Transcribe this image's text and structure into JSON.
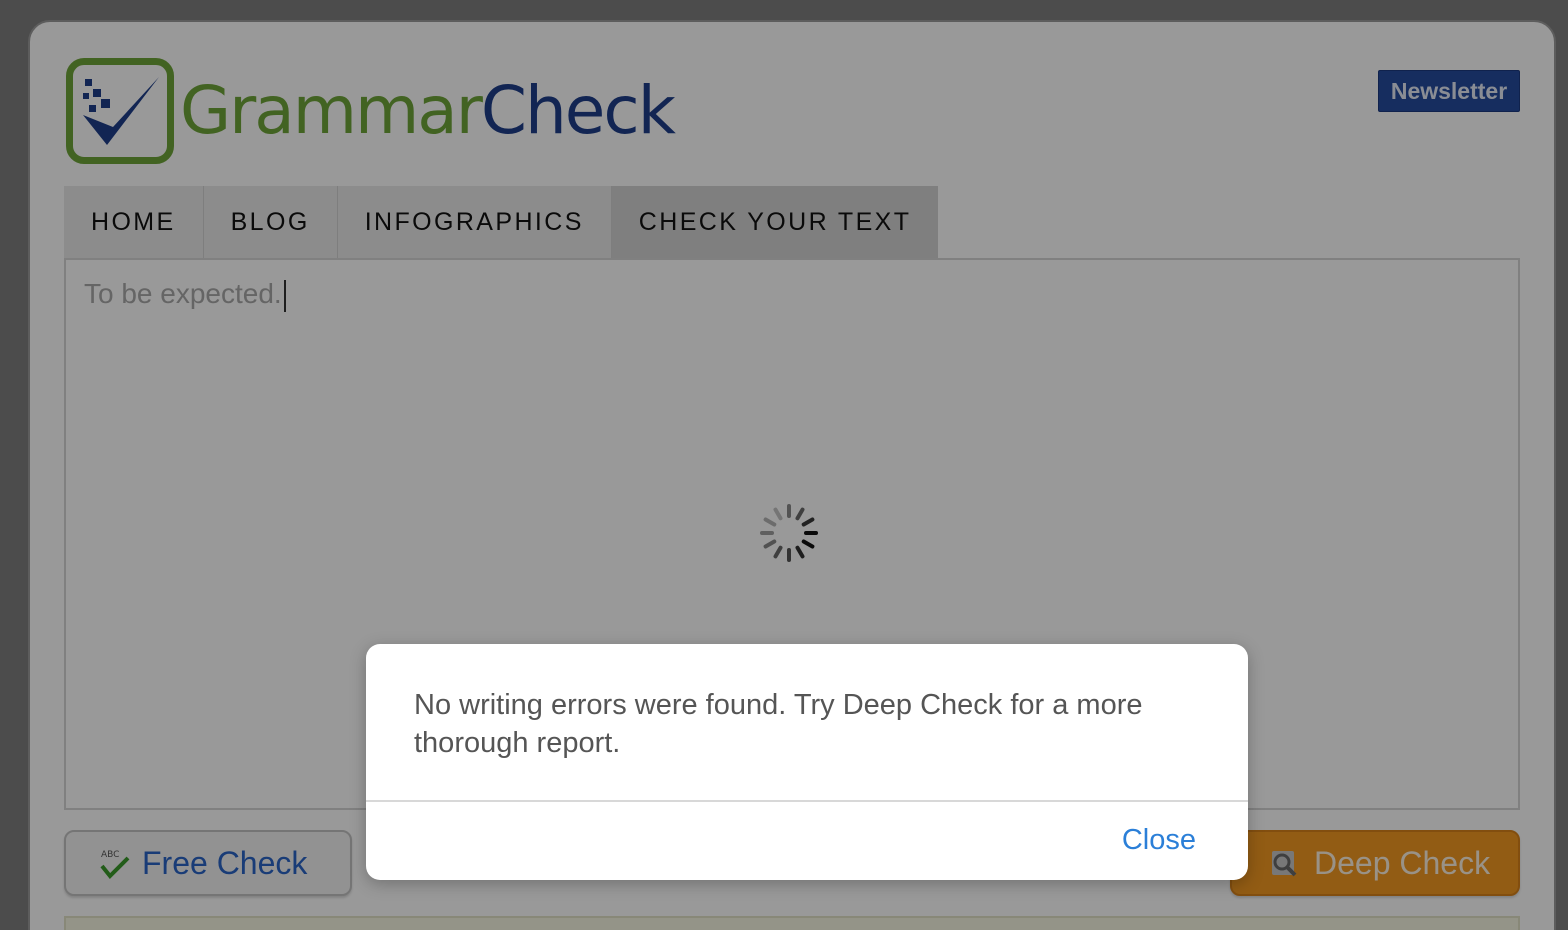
{
  "brand": {
    "name_part1": "Grammar",
    "name_part2": "Check",
    "logo_icon": "checkmark-icon",
    "colors": {
      "green": "#6fa53a",
      "navy": "#1f3f8a"
    }
  },
  "header": {
    "newsletter_label": "Newsletter"
  },
  "nav": {
    "items": [
      {
        "label": "HOME"
      },
      {
        "label": "BLOG"
      },
      {
        "label": "INFOGRAPHICS"
      },
      {
        "label": "CHECK YOUR TEXT",
        "active": true
      }
    ]
  },
  "editor": {
    "text": "To be expected.",
    "loading": true
  },
  "buttons": {
    "free_check": "Free Check",
    "deep_check": "Deep Check"
  },
  "modal": {
    "message": "No writing errors were found. Try Deep Check for a more thorough report.",
    "close_label": "Close",
    "accent": "#2b7fd8"
  }
}
